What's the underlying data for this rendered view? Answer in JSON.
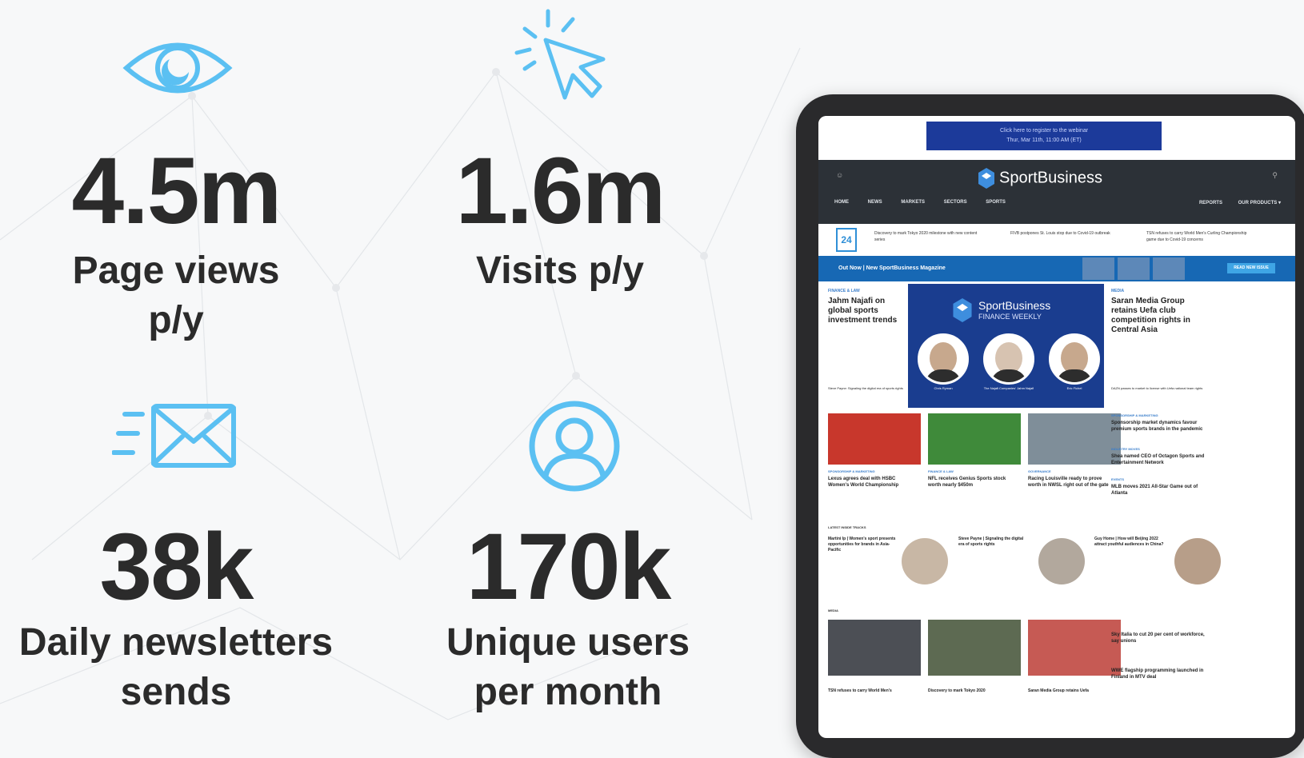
{
  "stats": [
    {
      "value": "4.5m",
      "label_line1": "Page views",
      "label_line2": "p/y",
      "icon": "eye-icon"
    },
    {
      "value": "1.6m",
      "label_line1": "Visits p/y",
      "label_line2": "",
      "icon": "cursor-click-icon"
    },
    {
      "value": "38k",
      "label_line1": "Daily newsletters",
      "label_line2": "sends",
      "icon": "mail-fast-icon"
    },
    {
      "value": "170k",
      "label_line1": "Unique users",
      "label_line2": "per month",
      "icon": "user-circle-icon"
    }
  ],
  "colors": {
    "accent": "#5bc0f2",
    "text": "#2b2b2b",
    "site_dark": "#2c3137",
    "site_blue": "#1768b4"
  },
  "tablet": {
    "ad_line1": "Click here to register to the webinar",
    "ad_line2": "Thur, Mar 11th, 11:00 AM (ET)",
    "logo": "SportBusiness",
    "nav": [
      "HOME",
      "NEWS",
      "MARKETS",
      "SECTORS",
      "SPORTS"
    ],
    "nav_right": [
      "REPORTS",
      "OUR PRODUCTS ▾"
    ],
    "date_box": "24",
    "ticker": [
      "Discovery to mark Tokyo 2020 milestone with new content series",
      "FIVB postpones St. Louis stop due to Covid-19 outbreak",
      "TSN refuses to carry World Men's Curling Championship game due to Covid-19 concerns"
    ],
    "banner_text": "Out Now | New SportBusiness Magazine",
    "banner_button": "READ NEW ISSUE",
    "left_kicker": "FINANCE & LAW",
    "left_headline": "Jahm Najafi on global sports investment trends",
    "left_sub": "Steve Payne: Signaling the digital era of sports rights",
    "feature_title": "SportBusiness",
    "feature_sub": "FINANCE WEEKLY",
    "feature_names": [
      "Chris Ryman",
      "The Najafi Companies' Jahm Najafi",
      "Eric Fichel"
    ],
    "right_kicker": "MEDIA",
    "right_headline": "Saran Media Group retains Uefa club competition rights in Central Asia",
    "right_sub": "DAZN passes to market to license with Uefa national team rights",
    "row2": [
      {
        "kicker": "SPONSORSHIP & MARKETING",
        "headline": "Lexus agrees deal with HSBC Women's World Championship"
      },
      {
        "kicker": "FINANCE & LAW",
        "headline": "NFL receives Genius Sports stock worth nearly $450m"
      },
      {
        "kicker": "GOVERNANCE",
        "headline": "Racing Louisville ready to prove worth in NWSL right out of the gate"
      }
    ],
    "row2_side": [
      {
        "kicker": "SPONSORSHIP & MARKETING",
        "headline": "Sponsorship market dynamics favour premium sports brands in the pandemic"
      },
      {
        "kicker": "INDUSTRY MOVES",
        "headline": "Shea named CEO of Octagon Sports and Entertainment Network"
      },
      {
        "kicker": "EVENTS",
        "headline": "MLB moves 2021 All-Star Game out of Atlanta"
      }
    ],
    "tracks_label": "LATEST INSIDE TRACKS",
    "tracks": [
      "Martini Ip | Women's sport presents opportunities for brands in Asia-Pacific",
      "Steve Payne | Signaling the digital era of sports rights",
      "Guy Home | How will Beijing 2022 attract youthful audiences in China?"
    ],
    "media_label": "MEDIA",
    "bottom": [
      "TSN refuses to carry World Men's",
      "Discovery to mark Tokyo 2020",
      "Saran Media Group retains Uefa"
    ],
    "bottom_side": [
      "Sky Italia to cut 20 per cent of workforce, say unions",
      "WWE flagship programming launched in Finland in MTV deal"
    ]
  }
}
